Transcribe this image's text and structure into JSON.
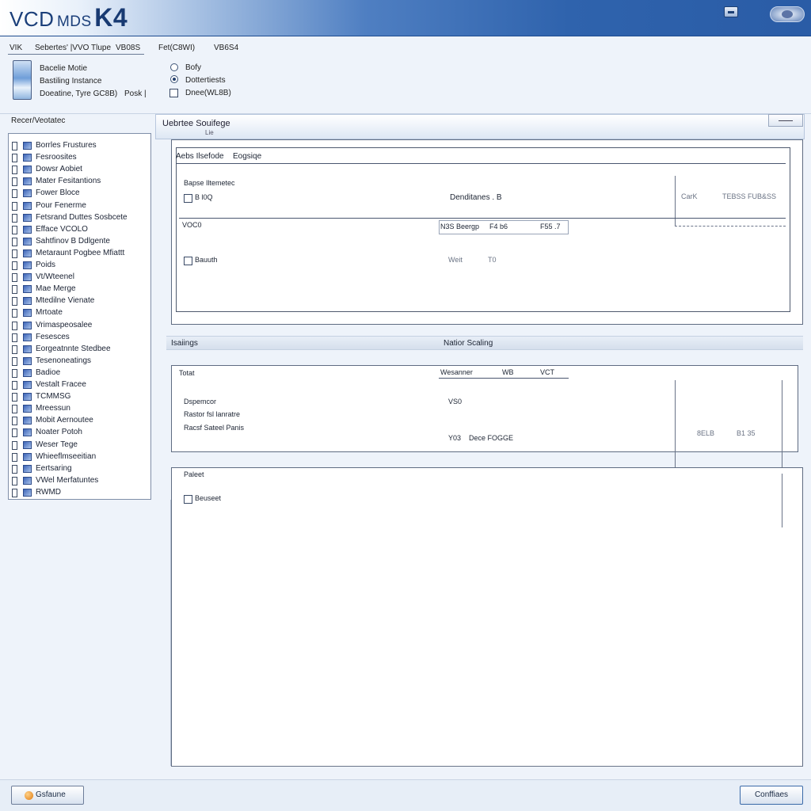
{
  "window": {
    "title_part1": "VCD",
    "title_part2": "MDS",
    "title_part3": "K4"
  },
  "infobar": {
    "field1": "VIK",
    "field2": "Sebertes' |VVO Tlupe",
    "field3": "VB08S",
    "field4": "Fet(C8WI)",
    "field5": "VB6S4"
  },
  "vehicle": {
    "line1": "Bacelie Motie",
    "line2": "Bastiling Instance",
    "line3": "Doeatine, Tyre GC8B)",
    "line3b": "Posk |"
  },
  "options": {
    "opt1": "Bofy",
    "opt2": "Dottertiests",
    "opt3": "Dnee(WL8B)"
  },
  "sidebar": {
    "title": "Recer/Veotatec",
    "items": [
      {
        "label": "Borrles Frustures"
      },
      {
        "label": "Fesroosites"
      },
      {
        "label": "Dowsr Aobiet"
      },
      {
        "label": "Mater Fesitantions"
      },
      {
        "label": "Fower Bloce"
      },
      {
        "label": "Pour Fenerme"
      },
      {
        "label": "Fetsrand Duttes Sosbcete"
      },
      {
        "label": "Efface VCOLO"
      },
      {
        "label": "Sahtfinov B Ddlgente"
      },
      {
        "label": "Metaraunt Pogbee Mfiattt"
      },
      {
        "label": "Poids"
      },
      {
        "label": "Vt/Wteenel"
      },
      {
        "label": "Mae Merge"
      },
      {
        "label": "Mtedilne Vienate"
      },
      {
        "label": "Mrtoate"
      },
      {
        "label": "Vrimaspeosalee"
      },
      {
        "label": "Fesesces"
      },
      {
        "label": "Eorgeatnnte Stedbee"
      },
      {
        "label": "Tesenoneatings"
      },
      {
        "label": "Badioe"
      },
      {
        "label": "Vestalt Fracee"
      },
      {
        "label": "TCMMSG"
      },
      {
        "label": "Mreessun"
      },
      {
        "label": "Mobit Aernoutee"
      },
      {
        "label": "Noater Potoh"
      },
      {
        "label": "Weser Tege"
      },
      {
        "label": "Whieeflmseeitian"
      },
      {
        "label": "Eertsaring"
      },
      {
        "label": "VWel Merfatuntes"
      },
      {
        "label": "RWMD"
      }
    ]
  },
  "main": {
    "tab_label": "Uebrtee Souifege",
    "tab_sub": "Lie",
    "panel1": {
      "header_a": "Aebs Ilsefode",
      "header_b": "Eogsiqe",
      "label_group": "Bapse Iltemetec",
      "check1": "B l0Q",
      "col_c": "Denditanes . B",
      "right_a": "CarK",
      "right_b": "TEBSS FUB&SS",
      "row_label": "VOC0",
      "cell_a": "N3S Beergp",
      "cell_b": "F4 b6",
      "cell_c": "F55 .7",
      "check2": "Bauuth",
      "cell_d": "Weit",
      "cell_e": "T0"
    },
    "section_left": "Isaiings",
    "section_right": "Natior Scaling",
    "panel2": {
      "label_top": "Totat",
      "col_a": "Wesanner",
      "col_b": "WB",
      "col_c": "VCT",
      "row1": "Dspemcor",
      "row2": "Rastor fsl lanratre",
      "row3": "Racsf Sateel Panis",
      "val1": "VS0",
      "val2a": "Y03",
      "val2b": "Dece FOGGE",
      "right_a": "8ELB",
      "right_b": "B1 35"
    },
    "panel3": {
      "label_top": "Paleet",
      "check": "Beuseet"
    }
  },
  "footer": {
    "back_label": "Gsfaune",
    "continue_label": "Conffiaes"
  }
}
